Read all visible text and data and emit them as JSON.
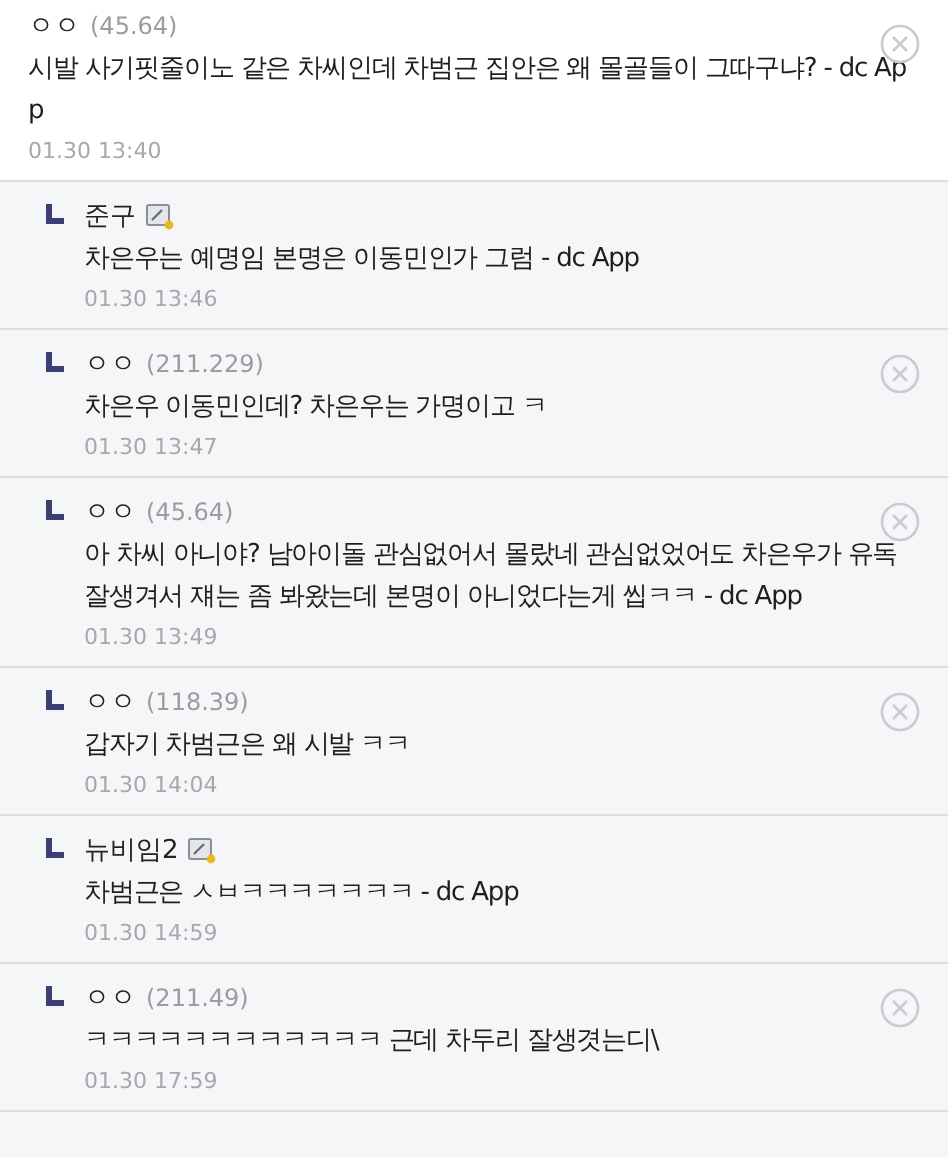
{
  "comments": [
    {
      "is_reply": false,
      "kind": "anonymous",
      "nickname": "ㅇㅇ",
      "ip": "(45.64)",
      "text": "시발 사기핏줄이노 같은 차씨인데 차범근 집안은 왜 몰골들이 그따구냐? - dc App",
      "date": "01.30 13:40",
      "deletable": true
    },
    {
      "is_reply": true,
      "kind": "member",
      "nickname": "준구",
      "text": "차은우는 예명임 본명은 이동민인가 그럼 - dc App",
      "date": "01.30 13:46",
      "deletable": false
    },
    {
      "is_reply": true,
      "kind": "anonymous",
      "nickname": "ㅇㅇ",
      "ip": "(211.229)",
      "text": "차은우 이동민인데? 차은우는 가명이고 ㅋ",
      "date": "01.30 13:47",
      "deletable": true
    },
    {
      "is_reply": true,
      "kind": "anonymous",
      "nickname": "ㅇㅇ",
      "ip": "(45.64)",
      "text": "아 차씨 아니야? 남아이돌 관심없어서 몰랐네 관심없었어도 차은우가 유독 잘생겨서 쟤는 좀 봐왔는데 본명이 아니었다는게 씹ㅋㅋ - dc App",
      "date": "01.30 13:49",
      "deletable": true
    },
    {
      "is_reply": true,
      "kind": "anonymous",
      "nickname": "ㅇㅇ",
      "ip": "(118.39)",
      "text": "갑자기 차범근은 왜 시발 ㅋㅋ",
      "date": "01.30 14:04",
      "deletable": true
    },
    {
      "is_reply": true,
      "kind": "member",
      "nickname": "뉴비임2",
      "text": "차범근은 ㅅㅂㅋㅋㅋㅋㅋㅋㅋ - dc App",
      "date": "01.30 14:59",
      "deletable": false
    },
    {
      "is_reply": true,
      "kind": "anonymous",
      "nickname": "ㅇㅇ",
      "ip": "(211.49)",
      "text": "ㅋㅋㅋㅋㅋㅋㅋㅋㅋㅋㅋㅋ 근데 차두리 잘생겻는디\\",
      "date": "01.30 17:59",
      "deletable": true
    }
  ]
}
